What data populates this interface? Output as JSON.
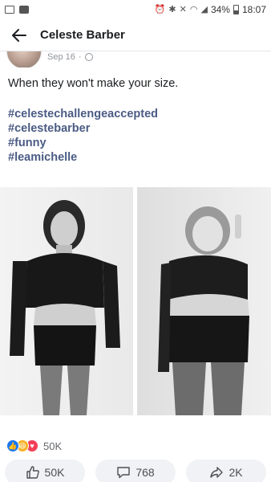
{
  "status_bar": {
    "battery": "34%",
    "time": "18:07"
  },
  "app_bar": {
    "title": "Celeste Barber"
  },
  "post": {
    "date": "Sep 16",
    "separator": "·",
    "text": "When they won't make your size.",
    "hashtags": [
      "#celestechallengeaccepted",
      "#celestebarber",
      "#funny",
      "#leamichelle"
    ]
  },
  "reactions": {
    "count": "50K"
  },
  "actions": {
    "like_count": "50K",
    "comment_count": "768",
    "share_count": "2K"
  }
}
